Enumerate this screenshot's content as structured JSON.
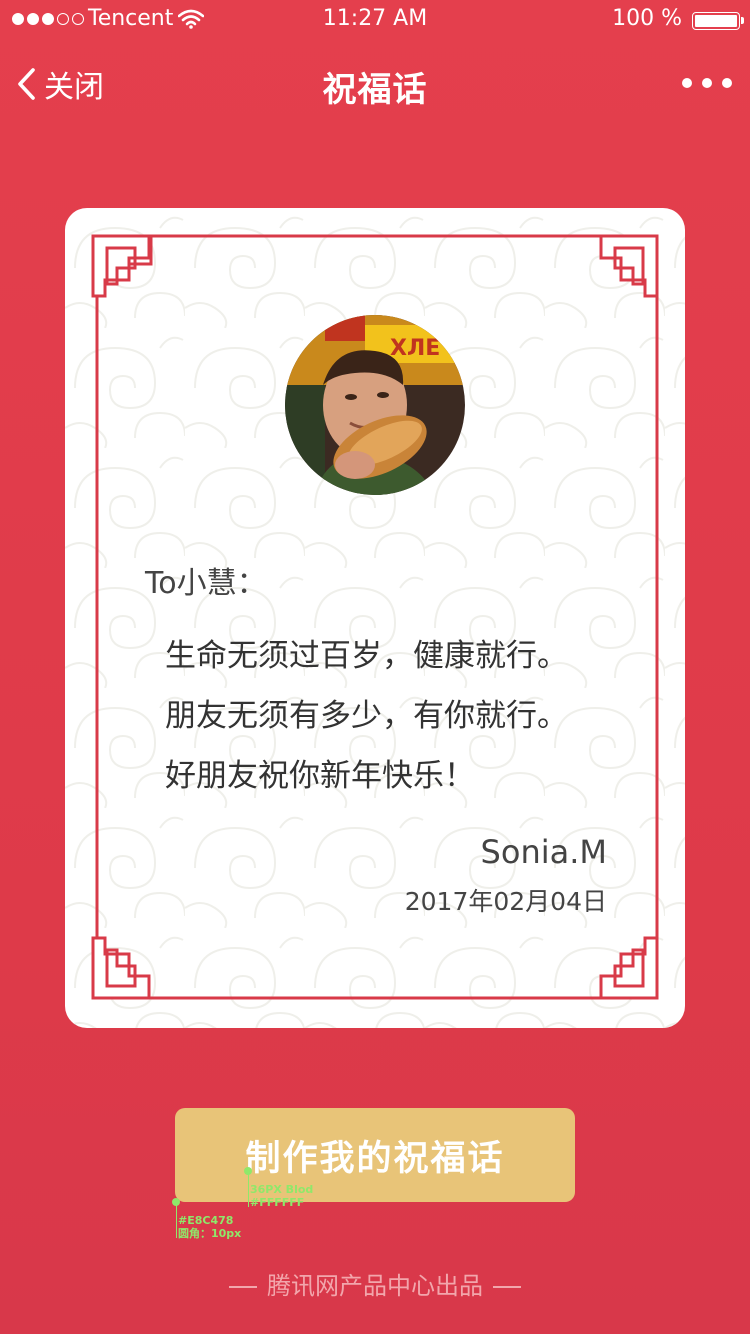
{
  "status_bar": {
    "carrier": "Tencent",
    "time": "11:27 AM",
    "battery": "100 %"
  },
  "nav": {
    "back_label": "关闭",
    "title": "祝福话"
  },
  "card": {
    "greeting": "To小慧：",
    "message_lines": [
      "生命无须过百岁，健康就行。",
      "朋友无须有多少，有你就行。",
      "好朋友祝你新年快乐！"
    ],
    "signature": "Sonia.M",
    "date": "2017年02月04日"
  },
  "button": {
    "label": "制作我的祝福话"
  },
  "annotations": {
    "font_spec": "36PX Blod",
    "font_color": "#FFFFFF",
    "bg_color": "#E8C478",
    "radius": "圆角：10px"
  },
  "footer": {
    "text": "腾讯网产品中心出品"
  },
  "colors": {
    "background": "#e43f4d",
    "frame": "#d83a48",
    "button": "#e8c478"
  }
}
